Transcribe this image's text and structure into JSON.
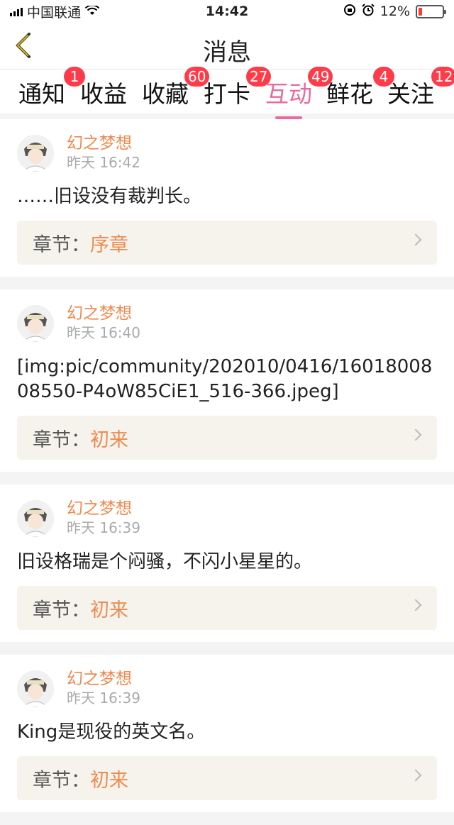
{
  "status_bar": {
    "carrier": "中国联通",
    "time": "14:42",
    "battery": "12%"
  },
  "nav": {
    "title": "消息"
  },
  "tabs": [
    {
      "label": "通知",
      "badge": "1"
    },
    {
      "label": "收益",
      "badge": ""
    },
    {
      "label": "收藏",
      "badge": "60"
    },
    {
      "label": "打卡",
      "badge": "27"
    },
    {
      "label": "互动",
      "badge": "49",
      "active": true
    },
    {
      "label": "鲜花",
      "badge": "4"
    },
    {
      "label": "关注",
      "badge": "12"
    }
  ],
  "messages": [
    {
      "user": "幻之梦想",
      "time": "昨天 16:42",
      "content": "……旧设没有裁判长。",
      "chapter_label": "章节：",
      "chapter": "序章"
    },
    {
      "user": "幻之梦想",
      "time": "昨天 16:40",
      "content": "[img:pic/community/202010/0416/1601800808550-P4oW85CiE1_516-366.jpeg]",
      "chapter_label": "章节：",
      "chapter": "初来"
    },
    {
      "user": "幻之梦想",
      "time": "昨天 16:39",
      "content": "旧设格瑞是个闷骚，不闪小星星的。",
      "chapter_label": "章节：",
      "chapter": "初来"
    },
    {
      "user": "幻之梦想",
      "time": "昨天 16:39",
      "content": "King是现役的英文名。",
      "chapter_label": "章节：",
      "chapter": "初来"
    }
  ],
  "colors": {
    "accent_pink": "#e86aa0",
    "name_orange": "#ef8a4e",
    "badge_red": "#ff3b4a",
    "chapter_bg": "#f5f3ec"
  }
}
